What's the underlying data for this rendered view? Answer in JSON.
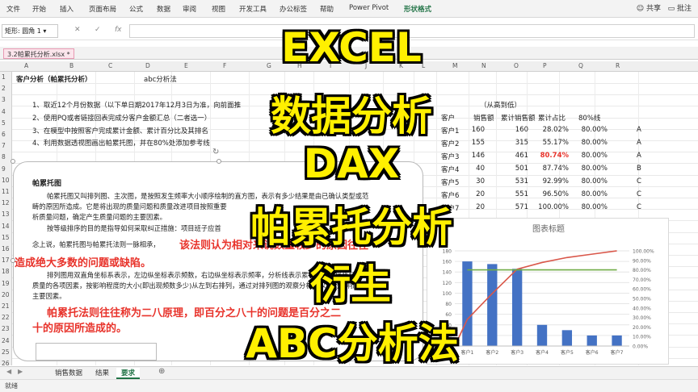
{
  "ribbon": {
    "tabs": [
      "文件",
      "开始",
      "插入",
      "页面布局",
      "公式",
      "数据",
      "审阅",
      "视图",
      "开发工具",
      "办公标签",
      "帮助",
      "Power Pivot",
      "形状格式"
    ],
    "share_label": "共享",
    "comment_label": "批注"
  },
  "formula_bar": {
    "name_box": "矩形: 圆角 1",
    "fx": "fx"
  },
  "document": {
    "tab_name": "3.2帕累托分析.xlsx *"
  },
  "columns": [
    "A",
    "B",
    "C",
    "D",
    "E",
    "F",
    "G",
    "H",
    "I",
    "J",
    "K",
    "L",
    "M",
    "N",
    "O",
    "P",
    "Q",
    "R"
  ],
  "rows": [
    "1",
    "2",
    "3",
    "4",
    "5",
    "6",
    "7",
    "8",
    "9",
    "10",
    "11",
    "12",
    "13",
    "14",
    "15",
    "16",
    "17",
    "18",
    "19",
    "20",
    "21",
    "22",
    "23",
    "24",
    "25",
    "26"
  ],
  "sheet": {
    "title": "客户分析（帕累托分析）",
    "subtitle": "abc分析法",
    "steps": [
      "1、取近12个月份数据（以下单日期2017年12月3日为准，向前面推",
      "2、使用PQ或者链接回表完成分客户金额汇总（二者选一）",
      "3、在模型中按照客户完成累计金额、累计百分比及其排名",
      "4、利用数据透视图画出帕累托图，并在80%处添加参考线"
    ],
    "order_note": "（从高到低）",
    "table_headers": [
      "客户",
      "销售额",
      "累计销售额",
      "累计占比",
      "80%线"
    ],
    "table_rows": [
      [
        "客户1",
        "160",
        "160",
        "28.02%",
        "80.00%",
        "A"
      ],
      [
        "客户2",
        "155",
        "315",
        "55.17%",
        "80.00%",
        "A"
      ],
      [
        "客户3",
        "146",
        "461",
        "80.74%",
        "80.00%",
        "A"
      ],
      [
        "客户4",
        "40",
        "501",
        "87.74%",
        "80.00%",
        "B"
      ],
      [
        "客户5",
        "30",
        "531",
        "92.99%",
        "80.00%",
        "C"
      ],
      [
        "客户6",
        "20",
        "551",
        "96.50%",
        "80.00%",
        "C"
      ],
      [
        "客户7",
        "20",
        "571",
        "100.00%",
        "80.00%",
        "C"
      ]
    ]
  },
  "textbox": {
    "heading": "帕累托图",
    "p1": "帕累托图又叫排列图、主次图，是按照发生频率大小顺序绘制的直方图，表示有多少结果是由已确认类型或范",
    "p1b": "畴的原因所造成。它是将出现的质量问题和质量改进项目按照重要",
    "p1c": "析质量问题，确定产生质量问题的主要因素。",
    "p2": "按等级排序的目的是指导如何采取纠正措施：项目班子应首",
    "p3a": "念上说，帕累托图与帕累托法则一脉相承，",
    "p3red": "该法则认为相对来说数量较少的原因往往",
    "p4red": "造成绝大多数的问题或缺陷。",
    "p5": "排列图用双直角坐标系表示，左边纵坐标表示频数，右边纵坐标表示频率，分析线表示累计频率，横坐标表示影响",
    "p5b": "质量的各项因素，按影响程度的大小(即出现频数多少)从左到右排列，通过对排列图的观察分析可以找出影响质量的",
    "p5c": "主要因素。",
    "p6red": "帕累托法则往往称为二八原理，即百分之八十的问题是百分之二",
    "p7red": "十的原因所造成的。"
  },
  "chart_data": {
    "type": "bar",
    "title": "图表标题",
    "categories": [
      "客户1",
      "客户2",
      "客户3",
      "客户4",
      "客户5",
      "客户6",
      "客户7"
    ],
    "series": [
      {
        "kind": "bar",
        "axis": "left",
        "values": [
          160,
          155,
          146,
          40,
          30,
          20,
          20
        ]
      },
      {
        "kind": "line",
        "axis": "right",
        "values": [
          28.02,
          55.17,
          80.74,
          87.74,
          92.99,
          96.5,
          100.0
        ]
      },
      {
        "kind": "line",
        "axis": "right",
        "values": [
          80,
          80,
          80,
          80,
          80,
          80,
          80
        ]
      }
    ],
    "ylim": [
      0,
      180
    ],
    "yticks": [
      "0",
      "20",
      "40",
      "60",
      "80",
      "100",
      "120",
      "140",
      "160",
      "180"
    ],
    "y2lim": [
      0,
      100
    ],
    "y2ticks": [
      "0.00%",
      "10.00%",
      "20.00%",
      "30.00%",
      "40.00%",
      "50.00%",
      "60.00%",
      "70.00%",
      "80.00%",
      "90.00%",
      "100.00%"
    ],
    "colors": {
      "bars": "#4472c4",
      "cum_line": "#d9574a",
      "ref_line": "#70ad47"
    }
  },
  "sheet_tabs": [
    "销售数据",
    "结果",
    "要求"
  ],
  "active_sheet": "要求",
  "status": {
    "left": "就绪"
  },
  "overlay": [
    "EXCEL",
    "数据分析",
    "DAX",
    "帕累托分析",
    "衍生",
    "ABC分析法"
  ]
}
